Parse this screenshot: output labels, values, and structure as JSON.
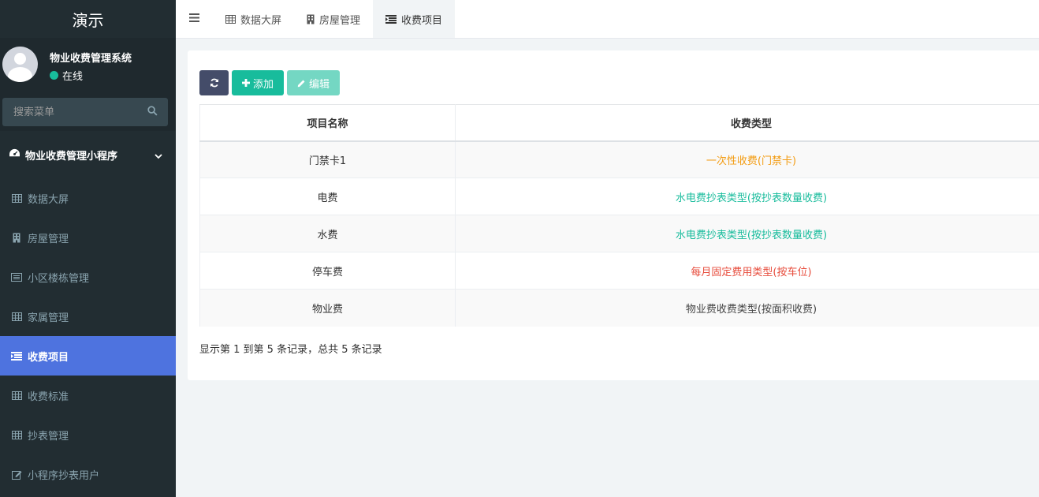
{
  "brand": "演示",
  "user": {
    "name": "物业收费管理系统",
    "status": "在线"
  },
  "search": {
    "placeholder": "搜索菜单"
  },
  "menu": {
    "group_label": "物业收费管理小程序",
    "items": [
      {
        "label": "数据大屏",
        "icon": "table-icon"
      },
      {
        "label": "房屋管理",
        "icon": "building-icon"
      },
      {
        "label": "小区楼栋管理",
        "icon": "list-alt-icon"
      },
      {
        "label": "家属管理",
        "icon": "table-icon"
      },
      {
        "label": "收费项目",
        "icon": "indent-icon",
        "active": true
      },
      {
        "label": "收费标准",
        "icon": "table-icon"
      },
      {
        "label": "抄表管理",
        "icon": "table-icon"
      },
      {
        "label": "小程序抄表用户",
        "icon": "edit-icon"
      }
    ]
  },
  "tabs": [
    {
      "label": "数据大屏",
      "icon": "table-icon"
    },
    {
      "label": "房屋管理",
      "icon": "building-icon"
    },
    {
      "label": "收费项目",
      "icon": "indent-icon",
      "active": true
    }
  ],
  "toolbar": {
    "add_label": "添加",
    "edit_label": "编辑"
  },
  "table": {
    "headers": [
      "项目名称",
      "收费类型"
    ],
    "rows": [
      {
        "name": "门禁卡1",
        "type": "一次性收费(门禁卡)",
        "type_color": "#f39c12"
      },
      {
        "name": "电费",
        "type": "水电费抄表类型(按抄表数量收费)",
        "type_color": "#18bc9c"
      },
      {
        "name": "水费",
        "type": "水电费抄表类型(按抄表数量收费)",
        "type_color": "#18bc9c"
      },
      {
        "name": "停车费",
        "type": "每月固定费用类型(按车位)",
        "type_color": "#e74c3c"
      },
      {
        "name": "物业费",
        "type": "物业费收费类型(按面积收费)",
        "type_color": "#444444"
      }
    ]
  },
  "pagination": {
    "info": "显示第 1 到第 5 条记录，总共 5 条记录"
  },
  "colors": {
    "sidebar_bg": "#222d32",
    "active_menu": "#4e73df",
    "primary": "#18bc9c"
  }
}
